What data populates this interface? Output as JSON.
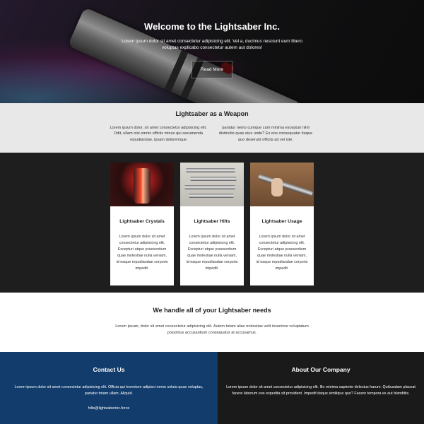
{
  "hero": {
    "title": "Welcome to the Lightsaber Inc.",
    "text": "Lorem ipsum dolor sit amet consectetur adipisicing elit. Vel a, ducimus nesciunt eum libero voluptas explicabo consectetur autem aut dolores!",
    "button_label": "Read More"
  },
  "weapon": {
    "title": "Lightsaber as a Weapon",
    "col1": "Lorem ipsum dolor, sit amet consectetur adipisicing elit. Odit, ullam nisi omnis officiis minus qui assumenda repudiandae, ipsam doloremque",
    "col2": "pariatur nemo cumque cum minima excepturi nihil distinctio quas eius unde? Ex eos consequatur itaque quo deserunt officiis ad vel iste."
  },
  "cards": [
    {
      "title": "Lightsaber Crystals",
      "text": "Lorem ipsum dolor sit amet consectetur adipisicing elit. Excepturi atque praesentium quae molestiae nulla veniam, id eaque repudiandae corporis impedit."
    },
    {
      "title": "Lightsaber Hilts",
      "text": "Lorem ipsum dolor sit amet consectetur adipisicing elit. Excepturi atque praesentium quae molestiae nulla veniam, id eaque repudiandae corporis impedit."
    },
    {
      "title": "Lightsaber Usage",
      "text": "Lorem ipsum dolor sit amet consectetur adipisicing elit. Excepturi atque praesentium quae molestiae nulla veniam, id eaque repudiandae corporis impedit."
    }
  ],
  "handle": {
    "title": "We handle all of your Lightsaber needs",
    "text": "Lorem ipsum, dolor sit amet consectetur adipisicing elit. Autem totam alias molestias velit inventore voluptatum possimus accusantium consequatur at accusamus."
  },
  "contact": {
    "title": "Contact Us",
    "text": "Lorem ipsum dolor sit amet consectetur adipisicing elit. Officia qui inventore adipisci nemo soluta quae voluptas, pariatur totam ullam. Aliquid.",
    "email": "hilts@lightsaberinc.force"
  },
  "about": {
    "title": "About Our Company",
    "text": "Lorem ipsum dolor sit amet consectetur adipisicing elit. Illo minima sapiente delectus harum. Quibusdam placeat facere laborum eos expedita sit provident. Impedit itaque similique quo? Facere tempora ex aut blanditiis."
  },
  "colors": {
    "contact_bg": "#123c6b",
    "about_bg": "#1a1a1a",
    "section_light": "#e8e8e8",
    "cards_bg": "#1e1e1e"
  }
}
